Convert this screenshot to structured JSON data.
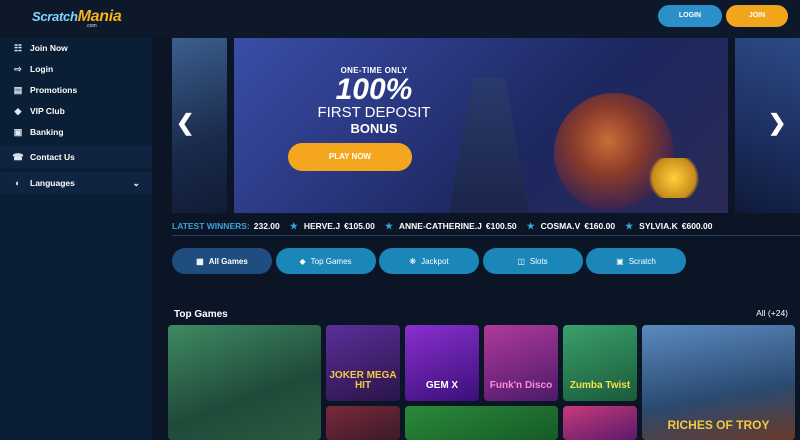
{
  "header": {
    "logo_main": "Scratch",
    "logo_accent": "Mania",
    "logo_sub": ".com",
    "login_label": "LOGIN",
    "join_label": "JOIN"
  },
  "sidebar": {
    "items": [
      {
        "label": "Join Now",
        "icon": "user-plus-icon"
      },
      {
        "label": "Login",
        "icon": "login-icon"
      },
      {
        "label": "Promotions",
        "icon": "gift-icon"
      },
      {
        "label": "VIP Club",
        "icon": "diamond-icon"
      },
      {
        "label": "Banking",
        "icon": "banking-icon"
      },
      {
        "label": "Contact Us",
        "icon": "phone-icon"
      },
      {
        "label": "Languages",
        "icon": "globe-icon"
      }
    ]
  },
  "banner": {
    "pre": "ONE-TIME ONLY",
    "big": "100%",
    "mid": "FIRST DEPOSIT",
    "bonus": "BONUS",
    "cta": "PLAY NOW"
  },
  "winners": {
    "label": "LATEST WINNERS:",
    "first_amount": "232.00",
    "entries": [
      {
        "name": "HERVE.J",
        "amount": "€105.00"
      },
      {
        "name": "ANNE-CATHERINE.J",
        "amount": "€100.50"
      },
      {
        "name": "COSMA.V",
        "amount": "€160.00"
      },
      {
        "name": "SYLVIA.K",
        "amount": "€600.00"
      }
    ]
  },
  "tabs": [
    {
      "label": "All Games",
      "icon": "grid-icon"
    },
    {
      "label": "Top Games",
      "icon": "diamond-icon"
    },
    {
      "label": "Jackpot",
      "icon": "jackpot-icon"
    },
    {
      "label": "Slots",
      "icon": "slots-icon"
    },
    {
      "label": "Scratch",
      "icon": "scratch-icon"
    }
  ],
  "section": {
    "title": "Top Games",
    "all_link": "All (+24)"
  },
  "games": [
    {
      "label": "",
      "color": "#2e6a4a"
    },
    {
      "label": "JOKER MEGA HIT",
      "color": "#3a1f63"
    },
    {
      "label": "GEM X",
      "color": "#5a1f8a"
    },
    {
      "label": "Funk'n Disco",
      "color": "#7a2a8a"
    },
    {
      "label": "Zumba Twist",
      "color": "#2a7a5a"
    },
    {
      "label": "RICHES OF TROY",
      "color": "#3e6fa0"
    }
  ],
  "colors": {
    "accent_blue": "#1a87b8",
    "accent_orange": "#f0a51d",
    "background": "#0b1526"
  }
}
